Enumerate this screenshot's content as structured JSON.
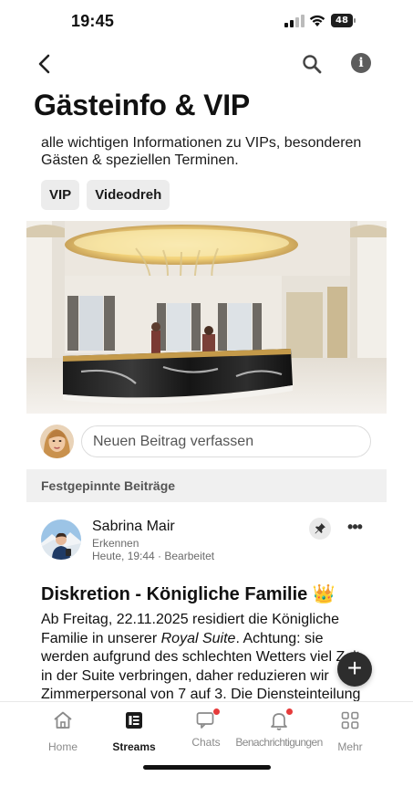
{
  "status_bar": {
    "time": "19:45",
    "battery": "48"
  },
  "page": {
    "title": "Gästeinfo & VIP",
    "description": "alle wichtigen Informationen zu VIPs, besonderen Gästen & speziellen Terminen.",
    "tags": [
      "VIP",
      "Videodreh"
    ]
  },
  "composer": {
    "placeholder": "Neuen Beitrag verfassen"
  },
  "pinned": {
    "header": "Festgepinnte Beiträge"
  },
  "post": {
    "author": "Sabrina Mair",
    "author_role": "Erkennen",
    "meta": "Heute, 19:44 · Bearbeitet",
    "title": "Diskretion - Königliche Familie 👑",
    "body_part1": "Ab Freitag, 22.11.2025 residiert die Königliche Familie in unserer ",
    "body_em": "Royal Suite",
    "body_part2": ". Achtung: sie werden aufgrund des schlechten Wetters viel Zeit in der Suite verbringen, daher reduzieren wir Zimmerpersonal von 7 auf 3. Die Diensteinteilung"
  },
  "tabs": [
    {
      "label": "Home",
      "icon": "home-icon",
      "active": false
    },
    {
      "label": "Streams",
      "icon": "streams-icon",
      "active": true
    },
    {
      "label": "Chats",
      "icon": "chat-icon",
      "active": false,
      "badge": true
    },
    {
      "label": "Benachrichtigungen",
      "icon": "bell-icon",
      "active": false,
      "badge": true
    },
    {
      "label": "Mehr",
      "icon": "grid-icon",
      "active": false
    }
  ],
  "colors": {
    "badge": "#e63b3b",
    "fab": "#2d2d2d",
    "accent_gold": "#f3d37a"
  }
}
